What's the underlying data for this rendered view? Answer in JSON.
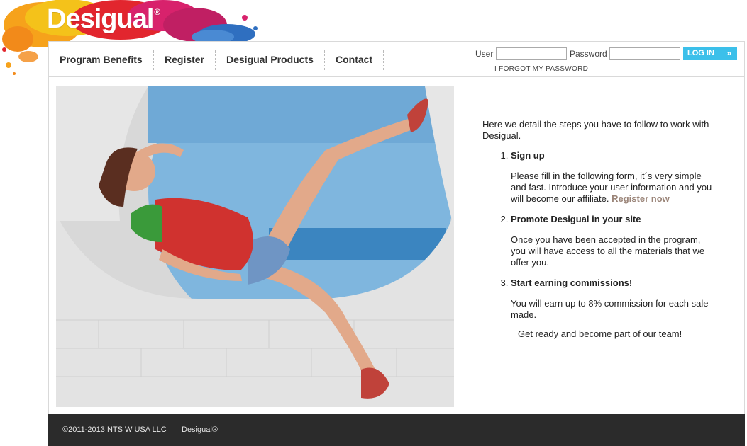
{
  "brand": {
    "logo_text": "Desigual",
    "logo_mark": "®",
    "colors": {
      "accent": "#3cc0ea",
      "link": "#9b8579",
      "footer": "#2b2b2b"
    }
  },
  "nav": {
    "items": [
      {
        "label": "Program Benefits"
      },
      {
        "label": "Register"
      },
      {
        "label": "Desigual Products"
      },
      {
        "label": "Contact"
      }
    ]
  },
  "login": {
    "user_label": "User",
    "user_value": "",
    "password_label": "Password",
    "password_value": "",
    "button_label": "LOG IN",
    "button_icon": "double-chevron-right-icon",
    "button_arrow": "»",
    "forgot_label": "I FORGOT MY PASSWORD"
  },
  "content": {
    "intro": "Here we detail the steps you have to follow to work with Desigual.",
    "steps": [
      {
        "title": "Sign up",
        "body": "Please fill in the following form, it´s very simple and fast. Introduce your user information and you will become our affiliate.",
        "link": "Register now"
      },
      {
        "title": "Promote Desigual in your site",
        "body": "Once you have been accepted in the program, you will have access to all the materials that we offer you.",
        "link": ""
      },
      {
        "title": "Start earning commissions!",
        "body": "You will earn up to 8% commission for each sale made.",
        "link": ""
      }
    ],
    "closing": "Get ready and become part of our team!"
  },
  "footer": {
    "copyright": "©2011-2013 NTS W USA LLC",
    "brand": "Desigual®"
  }
}
